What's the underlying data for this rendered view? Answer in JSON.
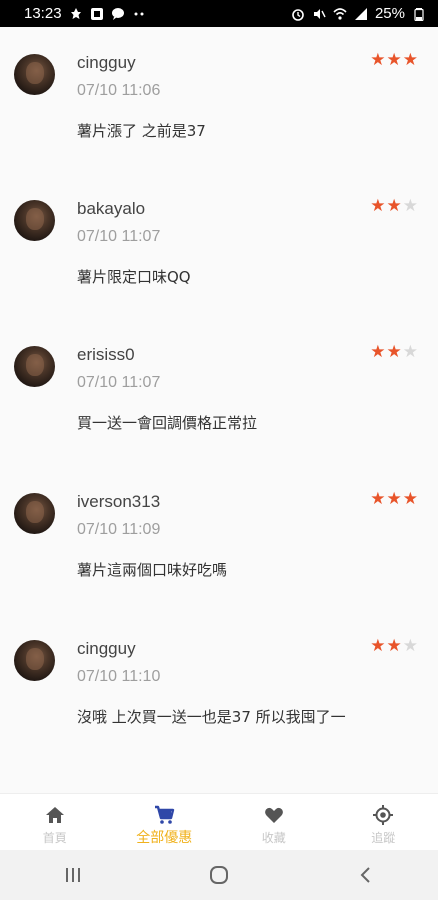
{
  "status_bar": {
    "time": "13:23",
    "battery": "25%"
  },
  "reviews": [
    {
      "username": "cingguy",
      "timestamp": "07/10 11:06",
      "comment": "薯片漲了  之前是37",
      "stars": [
        true,
        true,
        true
      ]
    },
    {
      "username": "bakayalo",
      "timestamp": "07/10 11:07",
      "comment": "薯片限定口味QQ",
      "stars": [
        true,
        true,
        false
      ]
    },
    {
      "username": "erisiss0",
      "timestamp": "07/10 11:07",
      "comment": "買一送一會回調價格正常拉",
      "stars": [
        true,
        true,
        false
      ]
    },
    {
      "username": "iverson313",
      "timestamp": "07/10 11:09",
      "comment": "薯片這兩個口味好吃嗎",
      "stars": [
        true,
        true,
        true
      ]
    },
    {
      "username": "cingguy",
      "timestamp": "07/10 11:10",
      "comment": "沒哦 上次買一送一也是37 所以我囤了一",
      "stars": [
        true,
        true,
        false
      ]
    }
  ],
  "bottom_nav": {
    "items": [
      {
        "label": "首頁",
        "icon": "home-icon"
      },
      {
        "label": "全部優惠",
        "icon": "cart-icon",
        "active": true
      },
      {
        "label": "收藏",
        "icon": "heart-icon"
      },
      {
        "label": "追蹤",
        "icon": "target-icon"
      }
    ]
  },
  "colors": {
    "star_on": "#e8542a",
    "star_off": "#d8d8d8",
    "nav_active": "#f0b21d",
    "nav_inactive": "#c7c7c7"
  }
}
